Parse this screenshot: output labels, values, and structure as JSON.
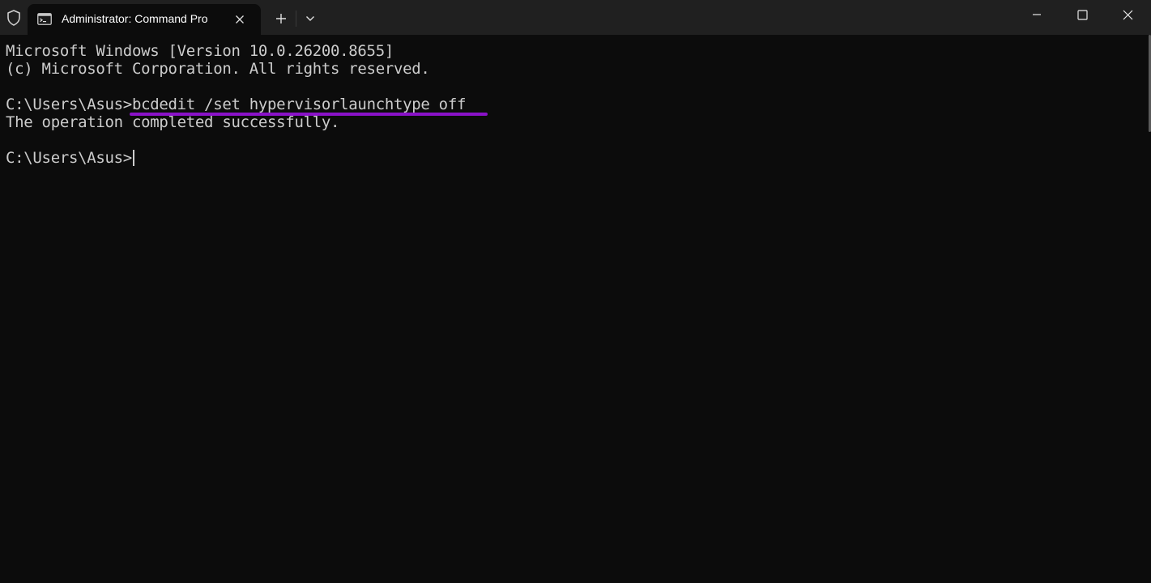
{
  "titlebar": {
    "tab_title": "Administrator: Command Pro",
    "icons": {
      "shield": "shield-icon",
      "terminal": "terminal-icon",
      "close_tab": "close-icon",
      "new_tab": "plus-icon",
      "tab_menu": "chevron-down-icon",
      "minimize": "minimize-icon",
      "maximize": "maximize-icon",
      "close_window": "close-icon"
    }
  },
  "terminal": {
    "line1": "Microsoft Windows [Version 10.0.26200.8655]",
    "line2": "(c) Microsoft Corporation. All rights reserved.",
    "prompt1": "C:\\Users\\Asus>",
    "command": "bcdedit /set hypervisorlaunchtype off",
    "result": "The operation completed successfully.",
    "prompt2": "C:\\Users\\Asus>"
  },
  "colors": {
    "background": "#0c0c0c",
    "titlebar": "#202020",
    "text": "#cccccc",
    "highlight": "#8a12c8"
  }
}
